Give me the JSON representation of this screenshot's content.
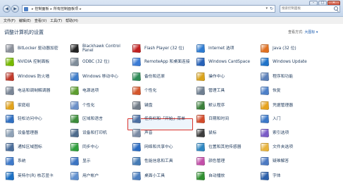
{
  "window": {
    "caption_buttons": [
      "–",
      "□",
      "✕"
    ],
    "nav_back": "◀",
    "nav_forward": "▶"
  },
  "address_bar": {
    "breadcrumbs": [
      "控制面板",
      "所有控制面板项"
    ],
    "separator": "▸",
    "dropdown_glyph": "▾",
    "refresh_glyph": "↻"
  },
  "search": {
    "placeholder": "搜索控制面板"
  },
  "menu": [
    "文件(F)",
    "编辑(E)",
    "查看(V)",
    "工具(T)",
    "帮助(H)"
  ],
  "header": {
    "title": "调整计算机的设置",
    "view_by_label": "查看方式:",
    "view_by_value": "大图标 ▾"
  },
  "columns": [
    [
      "BitLocker 驱动器加密",
      "NVIDIA 控制面板",
      "Windows 防火墙",
      "电话和调制解调器",
      "家庭组",
      "轻松访问中心",
      "设备管理器",
      "通知区域图标",
      "系统",
      "英特尔(R) 核芯显卡"
    ],
    [
      "Blackhawk Control Panel",
      "ODBC (32 位)",
      "Windows 移动中心",
      "电源选项",
      "个性化",
      "区域和语言",
      "设备和打印机",
      "同步中心",
      "显示",
      "用户帐户"
    ],
    [
      "Flash Player (32 位)",
      "RemoteApp 和桌面连接",
      "备份和还原",
      "个性化",
      "键盘",
      "任务栏和「开始」菜单",
      "声音",
      "网络和共享中心",
      "性能信息和工具",
      "桌面小工具"
    ],
    [
      "Internet 选项",
      "Windows CardSpace",
      "操作中心",
      "管理工具",
      "默认程序",
      "日期和时间",
      "鼠标",
      "位置和其他传感器",
      "颜色管理",
      "自动播放"
    ],
    [
      "Java (32 位)",
      "Windows Update",
      "程序和功能",
      "恢复",
      "凭据管理器",
      "入门",
      "索引选项",
      "文件夹选项",
      "疑难解答",
      "字体"
    ]
  ],
  "icon_colors": [
    [
      "#8a8f99",
      "#76b900",
      "#c0392b",
      "#7a8696",
      "#e1a21b",
      "#2f6fc1",
      "#8ea1b6",
      "#4a6d9a",
      "#3e79c9",
      "#1a6fc3"
    ],
    [
      "#222222",
      "#7f8c99",
      "#3d7cc9",
      "#5c9d2e",
      "#6a8fc7",
      "#3c8c3a",
      "#4d6b8c",
      "#2d9e3a",
      "#3b74c2",
      "#5f8fce"
    ],
    [
      "#c11f1f",
      "#3a7bd5",
      "#2e8b57",
      "#d4552a",
      "#707b87",
      "#4b6fa3",
      "#7a8aa3",
      "#2a6bc2",
      "#457bb5",
      "#4c7fc0"
    ],
    [
      "#2d7bd1",
      "#2661b8",
      "#d9a21a",
      "#6e7e90",
      "#3a7f3a",
      "#d34b2b",
      "#3c3c3c",
      "#2e86c1",
      "#c24ea8",
      "#2f8f2f"
    ],
    [
      "#e07020",
      "#1f73c9",
      "#5a7fb8",
      "#4c7fc8",
      "#e6a21c",
      "#3b78c8",
      "#7a5bc7",
      "#e8b33b",
      "#4b79c2",
      "#2b5faa"
    ]
  ],
  "icon_names": [
    [
      "bitlocker-icon",
      "nvidia-icon",
      "firewall-icon",
      "phone-modem-icon",
      "homegroup-icon",
      "ease-of-access-icon",
      "device-manager-icon",
      "notification-icons-icon",
      "system-icon",
      "intel-graphics-icon"
    ],
    [
      "blackhawk-icon",
      "odbc-icon",
      "mobility-center-icon",
      "power-options-icon",
      "personalization-icon",
      "region-language-icon",
      "devices-printers-icon",
      "sync-center-icon",
      "display-icon",
      "user-accounts-icon"
    ],
    [
      "flash-player-icon",
      "remoteapp-icon",
      "backup-restore-icon",
      "personalization-icon",
      "keyboard-icon",
      "taskbar-start-menu-icon",
      "sound-icon",
      "network-sharing-icon",
      "performance-icon",
      "desktop-gadgets-icon"
    ],
    [
      "internet-options-icon",
      "cardspace-icon",
      "action-center-icon",
      "admin-tools-icon",
      "default-programs-icon",
      "date-time-icon",
      "mouse-icon",
      "location-sensors-icon",
      "color-management-icon",
      "autoplay-icon"
    ],
    [
      "java-icon",
      "windows-update-icon",
      "programs-features-icon",
      "recovery-icon",
      "credential-manager-icon",
      "getting-started-icon",
      "indexing-options-icon",
      "folder-options-icon",
      "troubleshooting-icon",
      "fonts-icon"
    ]
  ],
  "selected_item": "声音"
}
